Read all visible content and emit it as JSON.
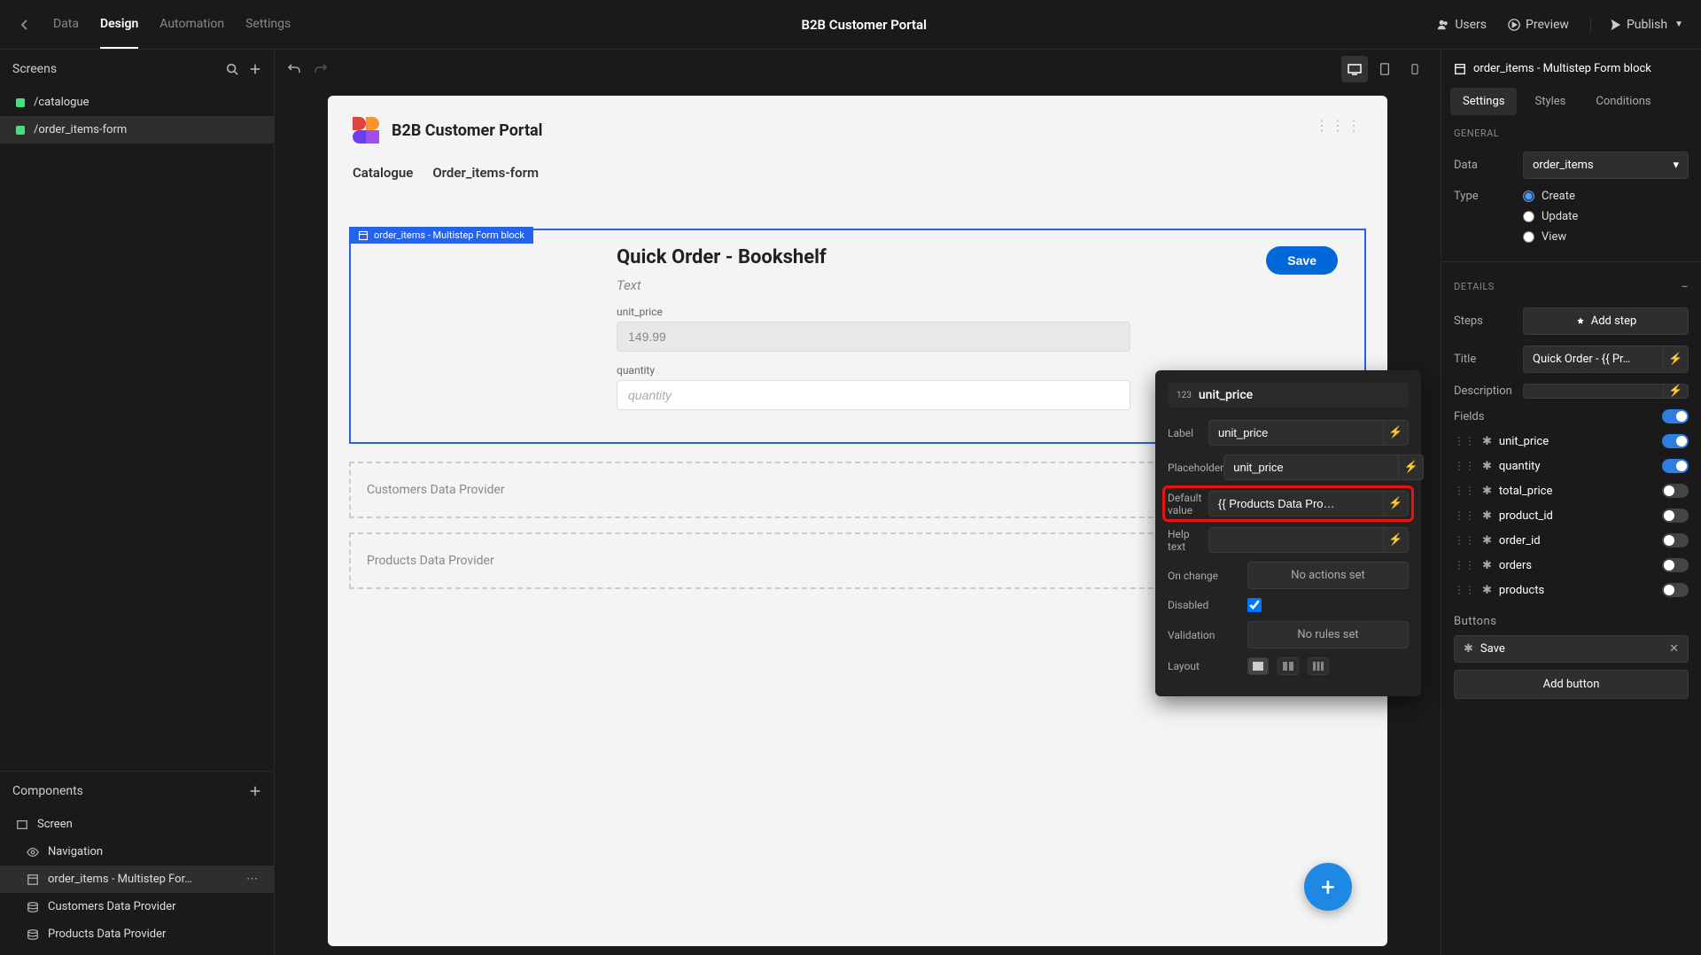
{
  "topbar": {
    "nav": [
      "Data",
      "Design",
      "Automation",
      "Settings"
    ],
    "activeNav": "Design",
    "appTitle": "B2B Customer Portal",
    "usersLabel": "Users",
    "previewLabel": "Preview",
    "publishLabel": "Publish"
  },
  "leftPanel": {
    "screensTitle": "Screens",
    "screens": [
      {
        "name": "/catalogue",
        "color": "green",
        "active": false
      },
      {
        "name": "/order_items-form",
        "color": "green",
        "active": true
      }
    ],
    "componentsTitle": "Components",
    "components": [
      {
        "name": "Screen",
        "icon": "screen"
      },
      {
        "name": "Navigation",
        "icon": "eye"
      },
      {
        "name": "order_items - Multistep For…",
        "icon": "form",
        "active": true,
        "more": true
      },
      {
        "name": "Customers Data Provider",
        "icon": "db"
      },
      {
        "name": "Products Data Provider",
        "icon": "db"
      }
    ]
  },
  "canvas": {
    "pageTitle": "B2B Customer Portal",
    "pageNav": [
      "Catalogue",
      "Order_items-form"
    ],
    "blockLabel": "order_items - Multistep Form block",
    "formTitle": "Quick Order - Bookshelf",
    "formSubtitle": "Text",
    "saveLabel": "Save",
    "fields": [
      {
        "label": "unit_price",
        "value": "149.99",
        "disabled": true
      },
      {
        "label": "quantity",
        "placeholder": "quantity",
        "disabled": false
      }
    ],
    "dataProviders": [
      "Customers Data Provider",
      "Products Data Provider"
    ]
  },
  "popover": {
    "badge": "123",
    "title": "unit_price",
    "rows": {
      "label": {
        "name": "Label",
        "value": "unit_price"
      },
      "placeholder": {
        "name": "Placeholder",
        "value": "unit_price"
      },
      "defaultValue": {
        "name": "Default value",
        "value": "{{ Products Data Pro…"
      },
      "helpText": {
        "name": "Help text",
        "value": ""
      },
      "onChange": {
        "name": "On change",
        "value": "No actions set"
      },
      "disabled": {
        "name": "Disabled",
        "checked": true
      },
      "validation": {
        "name": "Validation",
        "value": "No rules set"
      },
      "layout": {
        "name": "Layout"
      }
    }
  },
  "rightPanel": {
    "headerTitle": "order_items - Multistep Form block",
    "tabs": [
      "Settings",
      "Styles",
      "Conditions"
    ],
    "activeTab": "Settings",
    "general": {
      "title": "GENERAL",
      "dataLabel": "Data",
      "dataValue": "order_items",
      "typeLabel": "Type",
      "typeOptions": [
        "Create",
        "Update",
        "View"
      ],
      "typeSelected": "Create"
    },
    "details": {
      "title": "DETAILS",
      "stepsLabel": "Steps",
      "addStepLabel": "Add step",
      "titleLabel": "Title",
      "titleValue": "Quick Order - {{ Pr…",
      "descLabel": "Description",
      "descValue": "",
      "fieldsLabel": "Fields",
      "fieldsToggle": true,
      "fieldsList": [
        {
          "name": "unit_price",
          "on": true
        },
        {
          "name": "quantity",
          "on": true
        },
        {
          "name": "total_price",
          "on": false
        },
        {
          "name": "product_id",
          "on": false
        },
        {
          "name": "order_id",
          "on": false
        },
        {
          "name": "orders",
          "on": false
        },
        {
          "name": "products",
          "on": false
        }
      ],
      "buttonsLabel": "Buttons",
      "buttons": [
        "Save"
      ],
      "addButtonLabel": "Add button"
    }
  }
}
